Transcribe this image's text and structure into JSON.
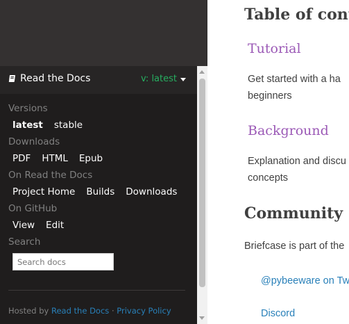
{
  "flyout": {
    "title": "Read the Docs",
    "version_label": "v: latest",
    "versions": {
      "title": "Versions",
      "items": [
        "latest",
        "stable"
      ]
    },
    "downloads": {
      "title": "Downloads",
      "items": [
        "PDF",
        "HTML",
        "Epub"
      ]
    },
    "on_rtd": {
      "title": "On Read the Docs",
      "items": [
        "Project Home",
        "Builds",
        "Downloads"
      ]
    },
    "on_github": {
      "title": "On GitHub",
      "items": [
        "View",
        "Edit"
      ]
    },
    "search": {
      "title": "Search",
      "placeholder": "Search docs"
    },
    "footer": {
      "hosted_by": "Hosted by",
      "rtd_link": "Read the Docs",
      "sep": "·",
      "privacy": "Privacy Policy"
    }
  },
  "main": {
    "page_heading": "Table of conte",
    "sections": [
      {
        "title": "Tutorial",
        "text_lines": [
          "Get started with a ha",
          "beginners"
        ]
      },
      {
        "title": "Background",
        "text_lines": [
          "Explanation and discu",
          "concepts"
        ]
      }
    ],
    "community": {
      "title": "Community",
      "text": "Briefcase is part of the",
      "links": [
        "@pybeeware on Tw",
        "Discord"
      ]
    }
  },
  "colors": {
    "sidebar_bg": "#343131",
    "flyout_bg": "#1f1d1d",
    "version_green": "#27ae60",
    "heading_purple": "#9b59b6",
    "link_blue": "#2980b9"
  }
}
